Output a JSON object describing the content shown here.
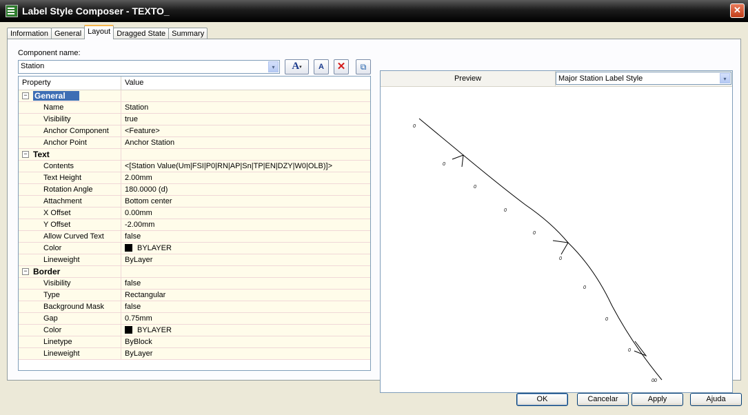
{
  "window": {
    "title": "Label Style Composer - TEXTO_",
    "close_glyph": "✕"
  },
  "tabs": [
    {
      "label": "Information"
    },
    {
      "label": "General"
    },
    {
      "label": "Layout"
    },
    {
      "label": "Dragged State"
    },
    {
      "label": "Summary"
    }
  ],
  "component": {
    "label": "Component name:",
    "value": "Station"
  },
  "toolbar": {
    "text_glyph": "A",
    "chev": "▾",
    "delete_glyph": "✕",
    "copy_glyph": "⧉",
    "textbox_glyph": "A"
  },
  "grid": {
    "col_property": "Property",
    "col_value": "Value",
    "general": {
      "name": "General",
      "rows": [
        {
          "p": "Name",
          "v": "Station"
        },
        {
          "p": "Visibility",
          "v": "true"
        },
        {
          "p": "Anchor Component",
          "v": "<Feature>"
        },
        {
          "p": "Anchor Point",
          "v": "Anchor Station"
        }
      ]
    },
    "text": {
      "name": "Text",
      "rows": [
        {
          "p": "Contents",
          "v": "<[Station Value(Um|FSI|P0|RN|AP|Sn|TP|EN|DZY|W0|OLB)]>"
        },
        {
          "p": "Text Height",
          "v": "2.00mm"
        },
        {
          "p": "Rotation Angle",
          "v": "180.0000 (d)"
        },
        {
          "p": "Attachment",
          "v": "Bottom center"
        },
        {
          "p": "X Offset",
          "v": "0.00mm"
        },
        {
          "p": "Y Offset",
          "v": "-2.00mm"
        },
        {
          "p": "Allow Curved Text",
          "v": "false"
        },
        {
          "p": "Color",
          "v": "BYLAYER"
        },
        {
          "p": "Lineweight",
          "v": "ByLayer"
        }
      ]
    },
    "border": {
      "name": "Border",
      "rows": [
        {
          "p": "Visibility",
          "v": "false"
        },
        {
          "p": "Type",
          "v": "Rectangular"
        },
        {
          "p": "Background Mask",
          "v": "false"
        },
        {
          "p": "Gap",
          "v": "0.75mm"
        },
        {
          "p": "Color",
          "v": "BYLAYER"
        },
        {
          "p": "Linetype",
          "v": "ByBlock"
        },
        {
          "p": "Lineweight",
          "v": "ByLayer"
        }
      ]
    }
  },
  "preview": {
    "label": "Preview",
    "style": "Major Station Label Style",
    "labels": [
      "0",
      "0",
      "0",
      "0",
      "0",
      "0",
      "0",
      "0",
      "0",
      "0",
      "00"
    ]
  },
  "buttons": {
    "ok": "OK",
    "cancel": "Cancelar",
    "apply": "Apply",
    "help": "Ajuda"
  },
  "arrow_glyph": "▾",
  "expander_glyph": "−"
}
